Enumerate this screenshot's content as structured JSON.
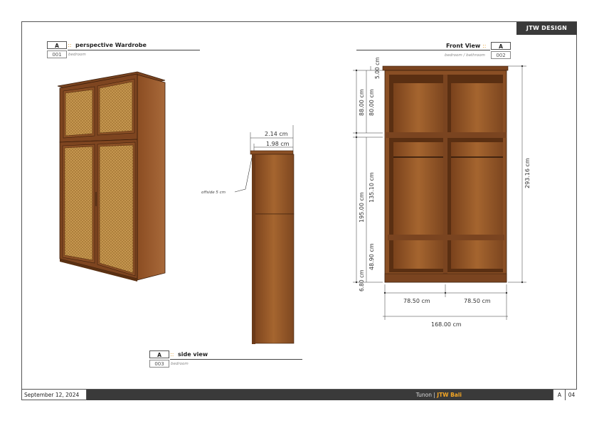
{
  "brand": "JTW DESIGN",
  "views": {
    "perspective": {
      "letter": "A",
      "sep": "::",
      "title": "perspective Wardrobe",
      "number": "001",
      "subtitle": "bedroom"
    },
    "front": {
      "letter": "A",
      "sep": "::",
      "title": "Front View",
      "number": "002",
      "subtitle": "bedroom / bathroom"
    },
    "side": {
      "letter": "A",
      "sep": "::",
      "title": "side view",
      "number": "003",
      "subtitle": "bedroom"
    }
  },
  "side_dims": {
    "top_width": "2.14 cm",
    "inner_width": "1.98 cm",
    "offside": "offside 5 cm"
  },
  "front_dims": {
    "top": "5.00 cm",
    "upper_outer": "88.00 cm",
    "upper_inner": "80.00 cm",
    "total_height": "293.16 cm",
    "lower_outer": "195.00 cm",
    "lower_inner": "135.10 cm",
    "bottom_shelf": "48.90 cm",
    "plinth": "6.80 cm",
    "left_width": "78.50 cm",
    "right_width": "78.50 cm",
    "total_width": "168.00 cm"
  },
  "footer": {
    "date": "September 12, 2024",
    "client_prefix": "Tunon |",
    "client_name": "JTW Bali",
    "sheet": "A",
    "page": "04"
  },
  "colors": {
    "wood": "#8a4f25",
    "wood_light": "#a0632f",
    "rattan": "#c99a52",
    "dark_bar": "#3a3a3a",
    "accent": "#f5a623"
  }
}
